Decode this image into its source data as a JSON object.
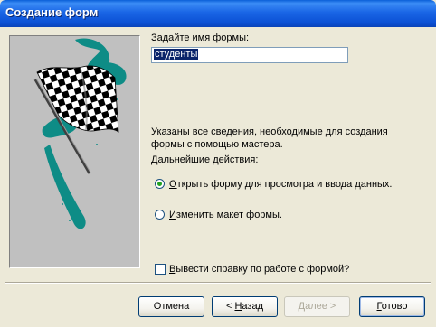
{
  "window": {
    "title": "Создание форм"
  },
  "form_name": {
    "label": "Задайте имя формы:",
    "value": "студенты"
  },
  "info": {
    "line1": "Указаны все сведения, необходимые для создания",
    "line2": "формы с помощью мастера.",
    "next_actions": "Дальнейшие действия:"
  },
  "options": [
    {
      "hotkey": "О",
      "rest": "ткрыть форму для просмотра и ввода данных.",
      "selected": true
    },
    {
      "hotkey": "И",
      "rest": "зменить макет формы.",
      "selected": false
    }
  ],
  "help_checkbox": {
    "hotkey": "В",
    "rest": "ывести справку по работе с формой?",
    "checked": false
  },
  "buttons": {
    "cancel": "Отмена",
    "back_prefix": "< ",
    "back_hotkey": "Н",
    "back_rest": "азад",
    "next": "Далее >",
    "finish_hotkey": "Г",
    "finish_rest": "отово"
  },
  "colors": {
    "title_bar": "#0a5fd8",
    "dialog_bg": "#ece9d8",
    "image_bg": "#c0c0c0",
    "teal_stroke": "#0e8c86",
    "selection": "#0a246a",
    "radio_dot": "#21a121"
  },
  "icons": {
    "wizard_image": "checkered-flag"
  }
}
